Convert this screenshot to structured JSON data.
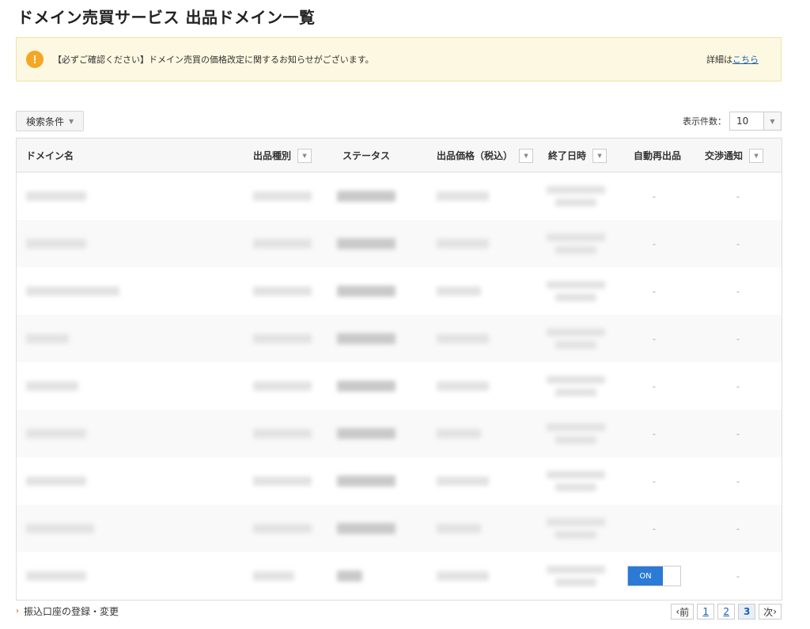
{
  "page": {
    "title": "ドメイン売買サービス 出品ドメイン一覧"
  },
  "notice": {
    "icon": "exclamation-icon",
    "text": "【必ずご確認ください】ドメイン売買の価格改定に関するお知らせがございます。",
    "detail_prefix": "詳細は",
    "detail_link": "こちら"
  },
  "search": {
    "label": "検索条件"
  },
  "display_count": {
    "label": "表示件数：",
    "value": "10"
  },
  "table": {
    "headers": {
      "domain": "ドメイン名",
      "type": "出品種別",
      "status": "ステータス",
      "price": "出品価格（税込）",
      "end": "終了日時",
      "auto": "自動再出品",
      "notify": "交渉通知"
    },
    "dash": "-",
    "toggle_label": "ON"
  },
  "footer": {
    "link": "振込口座の登録・変更"
  },
  "pagination": {
    "prev": "前",
    "pages": [
      "1",
      "2",
      "3"
    ],
    "current": "3",
    "next": "次"
  },
  "colors": {
    "accent": "#2b7ad6",
    "warning": "#f5a623",
    "notice_bg": "#fdf8e1"
  }
}
